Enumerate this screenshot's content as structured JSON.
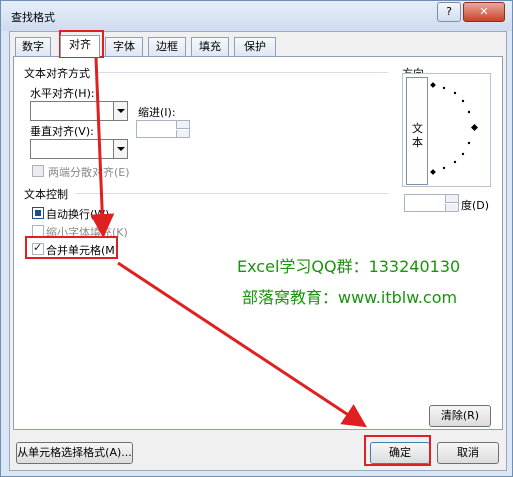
{
  "window": {
    "title": "查找格式",
    "help_label": "?",
    "close_label": "✕"
  },
  "tabs": [
    {
      "label": "数字"
    },
    {
      "label": "对齐"
    },
    {
      "label": "字体"
    },
    {
      "label": "边框"
    },
    {
      "label": "填充"
    },
    {
      "label": "保护"
    }
  ],
  "alignment": {
    "group_label": "文本对齐方式",
    "horizontal_label": "水平对齐(H):",
    "horizontal_value": "",
    "indent_label": "缩进(I):",
    "indent_value": "",
    "vertical_label": "垂直对齐(V):",
    "vertical_value": "",
    "justify_distributed_label": "两端分散对齐(E)"
  },
  "text_control": {
    "group_label": "文本控制",
    "wrap_label": "自动换行(W)",
    "shrink_label": "缩小字体填充(K)",
    "merge_label": "合并单元格(M)"
  },
  "orientation": {
    "group_label": "方向",
    "vertical_text": [
      "文",
      "本"
    ],
    "degree_value": "",
    "degree_label": "度(D)"
  },
  "annotations": {
    "line1": "Excel学习QQ群：133240130",
    "line2": "部落窝教育：www.itblw.com"
  },
  "buttons": {
    "clear": "清除(R)",
    "from_cell": "从单元格选择格式(A)...",
    "ok": "确定",
    "cancel": "取消"
  },
  "colors": {
    "highlight": "#e02020",
    "annotation_text": "#17950b"
  }
}
